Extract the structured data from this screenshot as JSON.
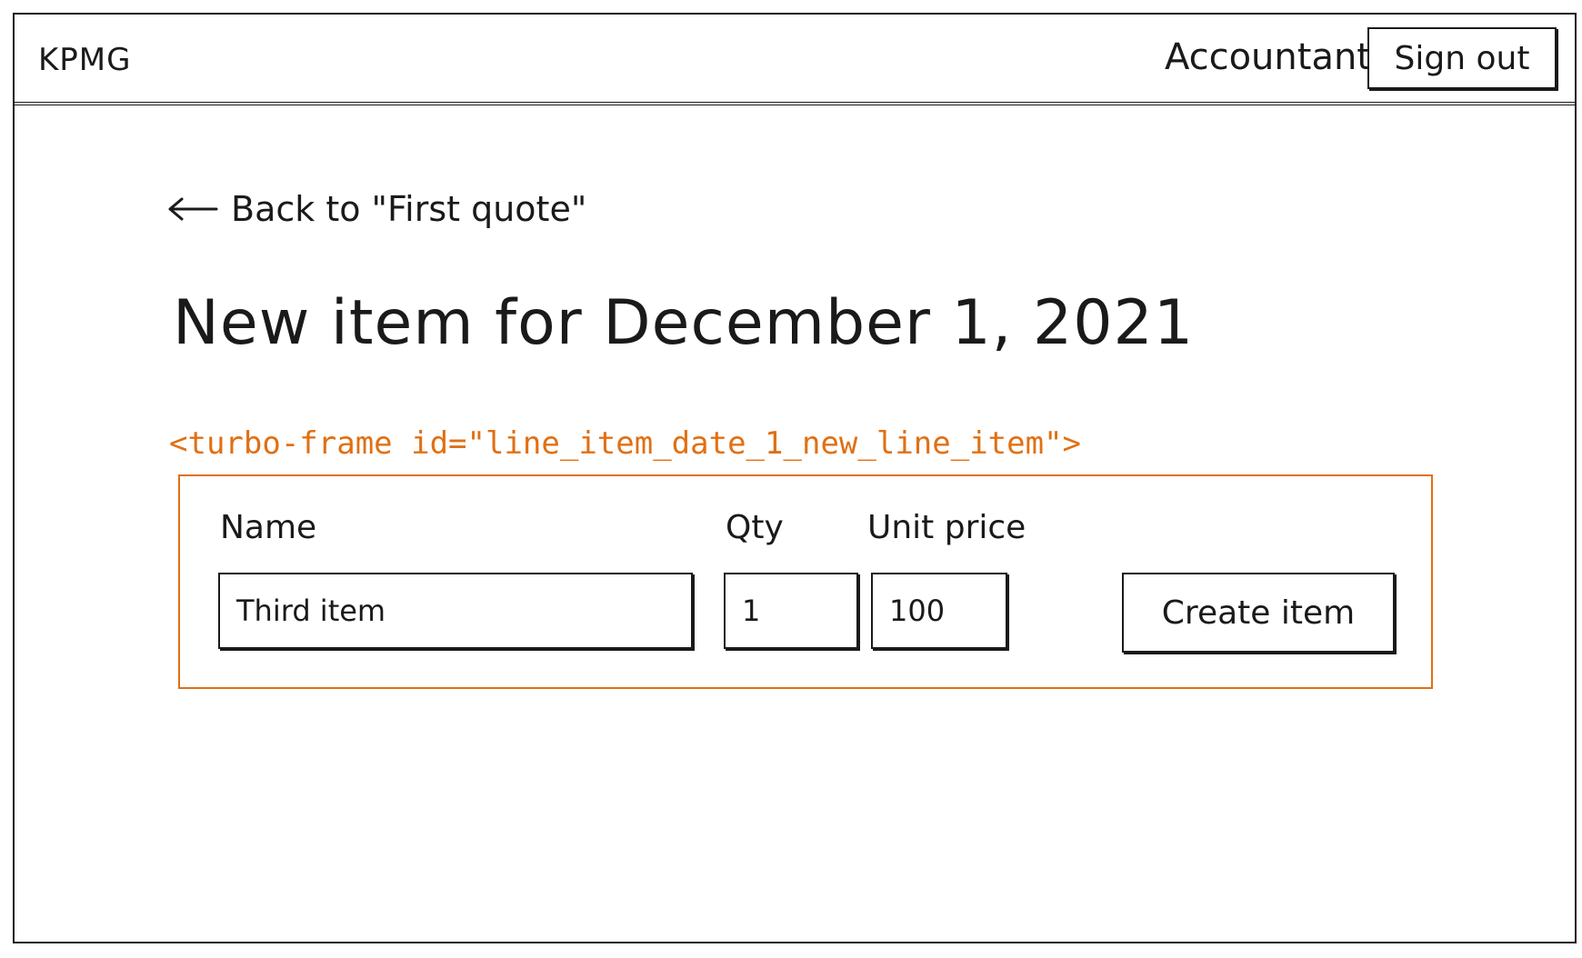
{
  "header": {
    "logo": "KPMG",
    "account_label": "Accountant",
    "sign_out_label": "Sign out"
  },
  "back_link": {
    "label": "Back to \"First quote\""
  },
  "page_title": "New item for December 1, 2021",
  "turbo_frame": {
    "annotation": "<turbo-frame id=\"line_item_date_1_new_line_item\">",
    "accent_color": "#e07014"
  },
  "form": {
    "name_label": "Name",
    "name_value": "Third item",
    "qty_label": "Qty",
    "qty_value": "1",
    "unit_price_label": "Unit price",
    "unit_price_value": "100",
    "submit_label": "Create item"
  }
}
